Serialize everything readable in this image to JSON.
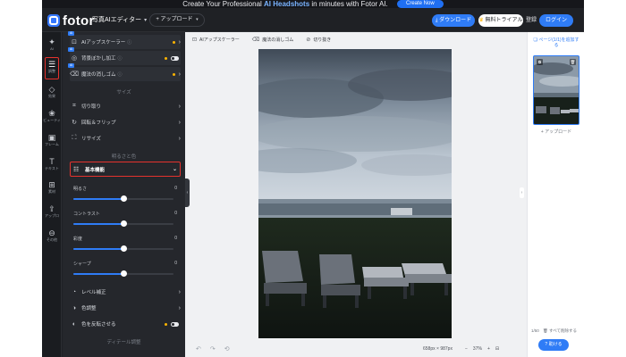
{
  "promo": {
    "text_before": "Create Your Professional",
    "highlight": "AI Headshots",
    "text_after": "in minutes with Fotor AI.",
    "button": "Create Now"
  },
  "topbar": {
    "logo": "fotor",
    "editor_label": "写真AIエディター",
    "upload_label": "+ アップロード",
    "download_label": "ダウンロード",
    "trial_label": "無料トライアル",
    "login_label": "登録",
    "signup_label": "ログイン"
  },
  "rail": {
    "items": [
      {
        "icon": "magic-wand-icon",
        "label": "AI"
      },
      {
        "icon": "adjust-icon",
        "label": "調整"
      },
      {
        "icon": "effects-icon",
        "label": "効果"
      },
      {
        "icon": "beauty-icon",
        "label": "ビューティ"
      },
      {
        "icon": "frame-icon",
        "label": "フレーム"
      },
      {
        "icon": "text-icon",
        "label": "テキスト"
      },
      {
        "icon": "elements-icon",
        "label": "素材"
      },
      {
        "icon": "upload-icon",
        "label": "アップロ"
      },
      {
        "icon": "more-icon",
        "label": "その他"
      }
    ]
  },
  "panel": {
    "ai_tools": [
      {
        "label": "AIアップスケーラー"
      },
      {
        "label": "背景ぼかし加工"
      },
      {
        "label": "魔法の消しゴム"
      }
    ],
    "size_header": "サイズ",
    "size_tools": [
      {
        "label": "切り取り"
      },
      {
        "label": "回転＆フリップ"
      },
      {
        "label": "リサイズ"
      }
    ],
    "brightness_header": "明るさと色",
    "basic_label": "基本機能",
    "sliders": [
      {
        "label": "明るさ",
        "value": "0",
        "level": 0.5
      },
      {
        "label": "コントラスト",
        "value": "0",
        "level": 0.5
      },
      {
        "label": "彩度",
        "value": "0",
        "level": 0.5
      },
      {
        "label": "シャープ",
        "value": "0",
        "level": 0.5
      }
    ],
    "color_tools": [
      {
        "label": "レベル補正"
      },
      {
        "label": "色調整"
      },
      {
        "label": "色を反転させる"
      }
    ],
    "detail_header": "ディテール調整",
    "badge": "AI"
  },
  "canvas": {
    "tools": [
      "AIアップスケーラー",
      "魔法の消しゴム",
      "切り抜き"
    ],
    "size": "658px × 987px",
    "zoom": "37%"
  },
  "pages": {
    "header": "ページ(1/1)を追加する",
    "add_page": "+ アップロード",
    "footer_count": "1/50",
    "footer_delete": "すべて削除する",
    "help_label": "助ける"
  }
}
